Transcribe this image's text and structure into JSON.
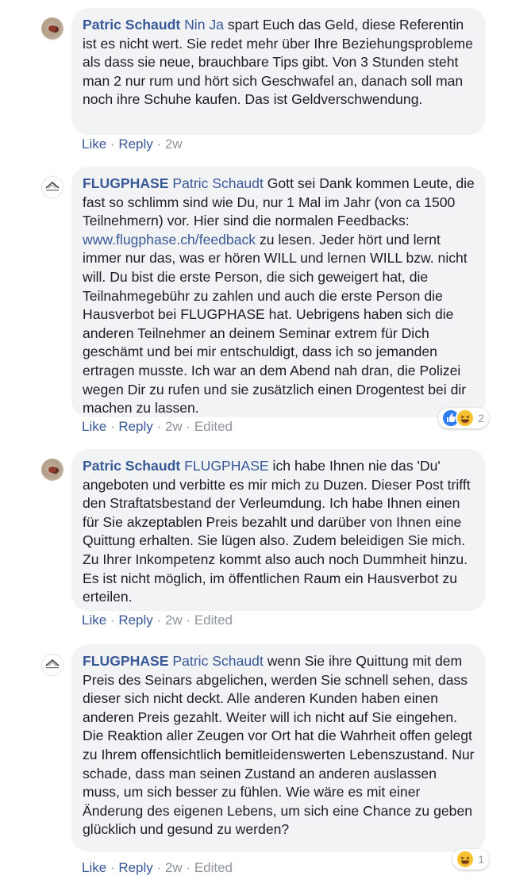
{
  "comments": [
    {
      "author": "Patric Schaudt",
      "mention": "Nin Ja",
      "text": " spart Euch das Geld, diese Referentin ist es nicht wert. Sie redet mehr über Ihre Beziehungsprobleme als dass sie neue, brauchbare Tips gibt. Von 3 Stunden steht man 2 nur rum und hört sich Geschwafel an, danach soll man noch ihre Schuhe kaufen. Das ist Geldverschwendung.",
      "like_label": "Like",
      "reply_label": "Reply",
      "time": "2w"
    },
    {
      "author": "FLUGPHASE",
      "mention": "Patric Schaudt",
      "text_a": " Gott sei Dank kommen Leute, die fast so schlimm sind wie Du, nur 1 Mal im Jahr (von ca 1500 Teilnehmern) vor. Hier sind die normalen Feedbacks: ",
      "link": "www.flugphase.ch/feedback",
      "text_b": " zu lesen. Jeder hört und lernt immer nur das, was er hören WILL und lernen WILL bzw. nicht will. Du bist die erste Person, die sich geweigert hat, die Teilnahmegebühr zu zahlen und auch die erste Person die Hausverbot bei FLUGPHASE hat. Uebrigens haben sich die anderen Teilnehmer an deinem Seminar extrem für Dich geschämt und bei mir entschuldigt, dass ich so jemanden ertragen musste. Ich war an dem Abend nah dran, die Polizei wegen Dir zu rufen und sie zusätzlich einen Drogentest bei dir machen zu lassen.",
      "like_label": "Like",
      "reply_label": "Reply",
      "time": "2w",
      "edited": "Edited",
      "reaction_count": "2",
      "reaction_icons": [
        "like-icon",
        "haha-icon"
      ]
    },
    {
      "author": "Patric Schaudt",
      "mention": "FLUGPHASE",
      "text": " ich habe Ihnen nie das 'Du' angeboten und verbitte es mir mich zu Duzen. Dieser Post trifft den Straftatsbestand der Verleumdung. Ich habe Ihnen einen für Sie akzeptablen Preis bezahlt und darüber von Ihnen eine Quittung erhalten. Sie lügen also. Zudem beleidigen Sie mich. Zu Ihrer Inkompetenz kommt also auch noch Dummheit hinzu. Es ist nicht möglich, im öffentlichen Raum ein Hausverbot zu erteilen.",
      "like_label": "Like",
      "reply_label": "Reply",
      "time": "2w",
      "edited": "Edited"
    },
    {
      "author": "FLUGPHASE",
      "mention": "Patric Schaudt",
      "text": " wenn Sie ihre Quittung mit dem Preis des Seinars abgelichen, werden Sie schnell sehen, dass dieser sich nicht deckt. Alle anderen Kunden haben einen anderen Preis gezahlt. Weiter will ich nicht auf Sie eingehen. Die Reaktion aller Zeugen vor Ort hat die Wahrheit offen gelegt zu Ihrem offensichtlich bemitleidenswerten Lebenszustand. Nur schade, dass man seinen Zustand an anderen auslassen muss, um sich besser zu fühlen. Wie wäre es mit einer Änderung des eigenen Lebens, um sich eine Chance zu geben glücklich und gesund zu werden?",
      "like_label": "Like",
      "reply_label": "Reply",
      "time": "2w",
      "edited": "Edited",
      "reaction_count": "1",
      "reaction_icons": [
        "haha-icon"
      ]
    }
  ],
  "separator": "·",
  "colors": {
    "author_link": "#385898",
    "bubble_bg": "#f2f3f5",
    "meta_gray": "#90949c",
    "like_blue": "#2e7cf6",
    "haha_yellow": "#f7c22e"
  }
}
